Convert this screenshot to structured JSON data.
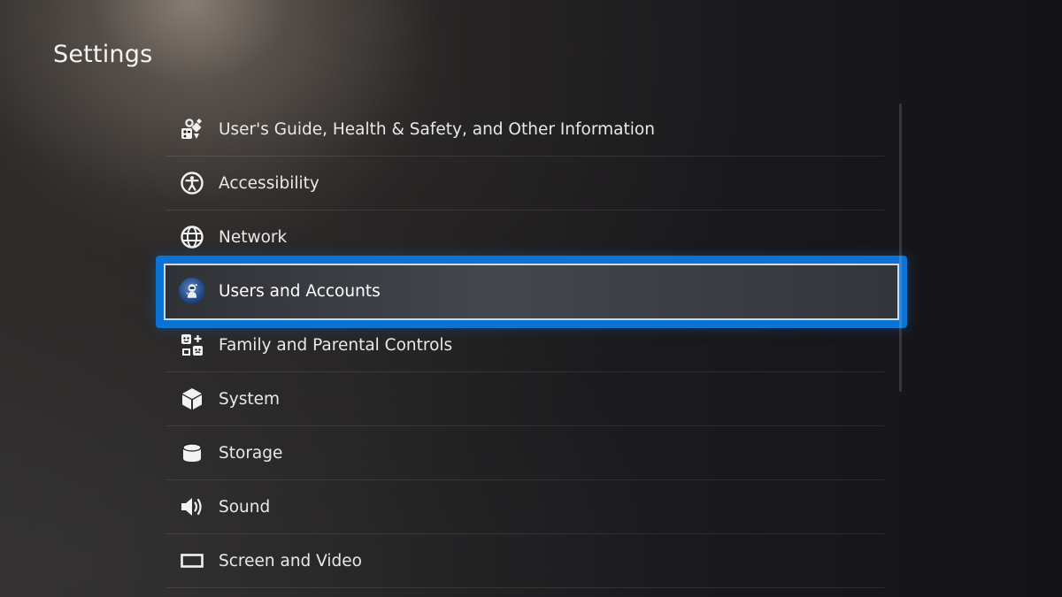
{
  "page": {
    "title": "Settings"
  },
  "settings": {
    "items": [
      {
        "label": "User's Guide, Health & Safety, and Other Information",
        "icon": "guide-icon"
      },
      {
        "label": "Accessibility",
        "icon": "accessibility-icon"
      },
      {
        "label": "Network",
        "icon": "globe-icon"
      },
      {
        "label": "Users and Accounts",
        "icon": "avatar-icon",
        "selected": true
      },
      {
        "label": "Family and Parental Controls",
        "icon": "family-icon"
      },
      {
        "label": "System",
        "icon": "cube-icon"
      },
      {
        "label": "Storage",
        "icon": "storage-icon"
      },
      {
        "label": "Sound",
        "icon": "speaker-icon"
      },
      {
        "label": "Screen and Video",
        "icon": "screen-icon"
      }
    ]
  },
  "colors": {
    "focus_border": "#0a73d4",
    "text": "#e9e9e9",
    "background": "#16161a"
  }
}
